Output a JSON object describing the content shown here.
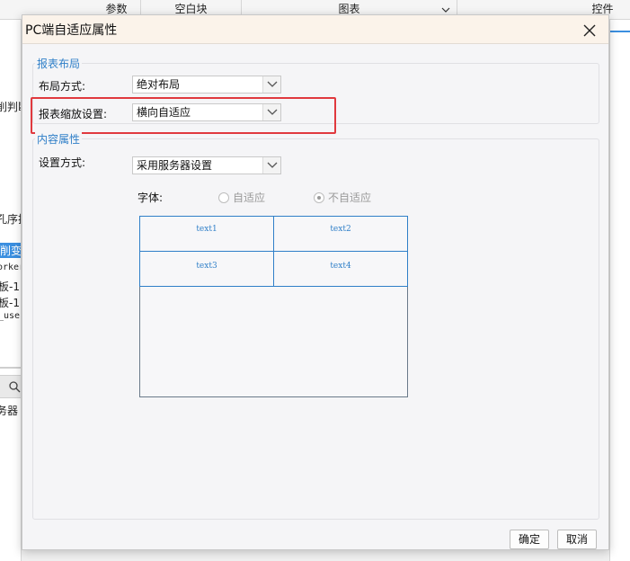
{
  "background": {
    "top_tabs": [
      "参数",
      "空白块",
      "图表",
      "控件"
    ],
    "left_fragments": [
      "削判断",
      "孔序排",
      "削变色",
      "orker",
      "板-1",
      "板-1",
      "_use",
      "务器"
    ]
  },
  "dialog": {
    "title": "PC端自适应属性",
    "report_layout": {
      "group_label": "报表布局",
      "layout_mode_label": "布局方式:",
      "layout_mode_value": "绝对布局",
      "scale_label": "报表缩放设置:",
      "scale_value": "横向自适应"
    },
    "content_props": {
      "group_label": "内容属性",
      "setting_mode_label": "设置方式:",
      "setting_mode_value": "采用服务器设置",
      "font_label": "字体:",
      "font_options": [
        {
          "label": "自适应",
          "checked": false
        },
        {
          "label": "不自适应",
          "checked": true
        }
      ],
      "preview_cells": [
        "text1",
        "text2",
        "text3",
        "text4"
      ]
    },
    "buttons": {
      "ok": "确定",
      "cancel": "取消"
    }
  },
  "colors": {
    "accent": "#2f7fc8",
    "highlight": "#e0393e",
    "title_bar": "#fbf3ea"
  }
}
